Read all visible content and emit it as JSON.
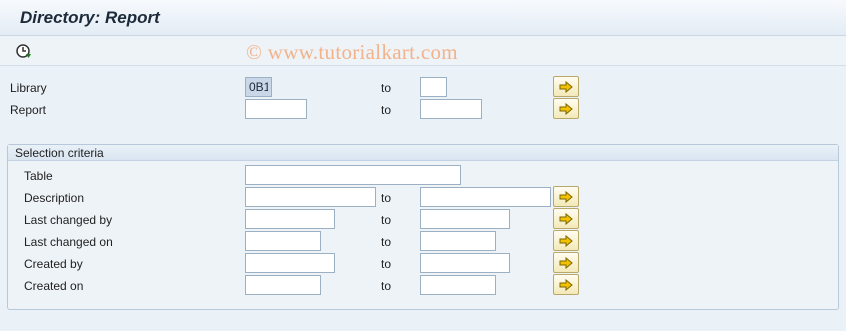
{
  "window": {
    "title": "Directory: Report"
  },
  "toolbar": {
    "execute_icon": "clock-execute-icon"
  },
  "watermark": "© www.tutorialkart.com",
  "fields": {
    "library": {
      "label": "Library",
      "from": "0B1",
      "to_label": "to",
      "to": ""
    },
    "report": {
      "label": "Report",
      "from": "",
      "to_label": "to",
      "to": ""
    }
  },
  "selection": {
    "title": "Selection criteria",
    "table": {
      "label": "Table",
      "value": ""
    },
    "description": {
      "label": "Description",
      "from": "",
      "to_label": "to",
      "to": ""
    },
    "last_changed_by": {
      "label": "Last changed by",
      "from": "",
      "to_label": "to",
      "to": ""
    },
    "last_changed_on": {
      "label": "Last changed on",
      "from": "",
      "to_label": "to",
      "to": ""
    },
    "created_by": {
      "label": "Created by",
      "from": "",
      "to_label": "to",
      "to": ""
    },
    "created_on": {
      "label": "Created on",
      "from": "",
      "to_label": "to",
      "to": ""
    }
  },
  "colors": {
    "accent": "#1c2a3a",
    "arrow": "#e0b400",
    "watermark": "#f2b28a"
  }
}
